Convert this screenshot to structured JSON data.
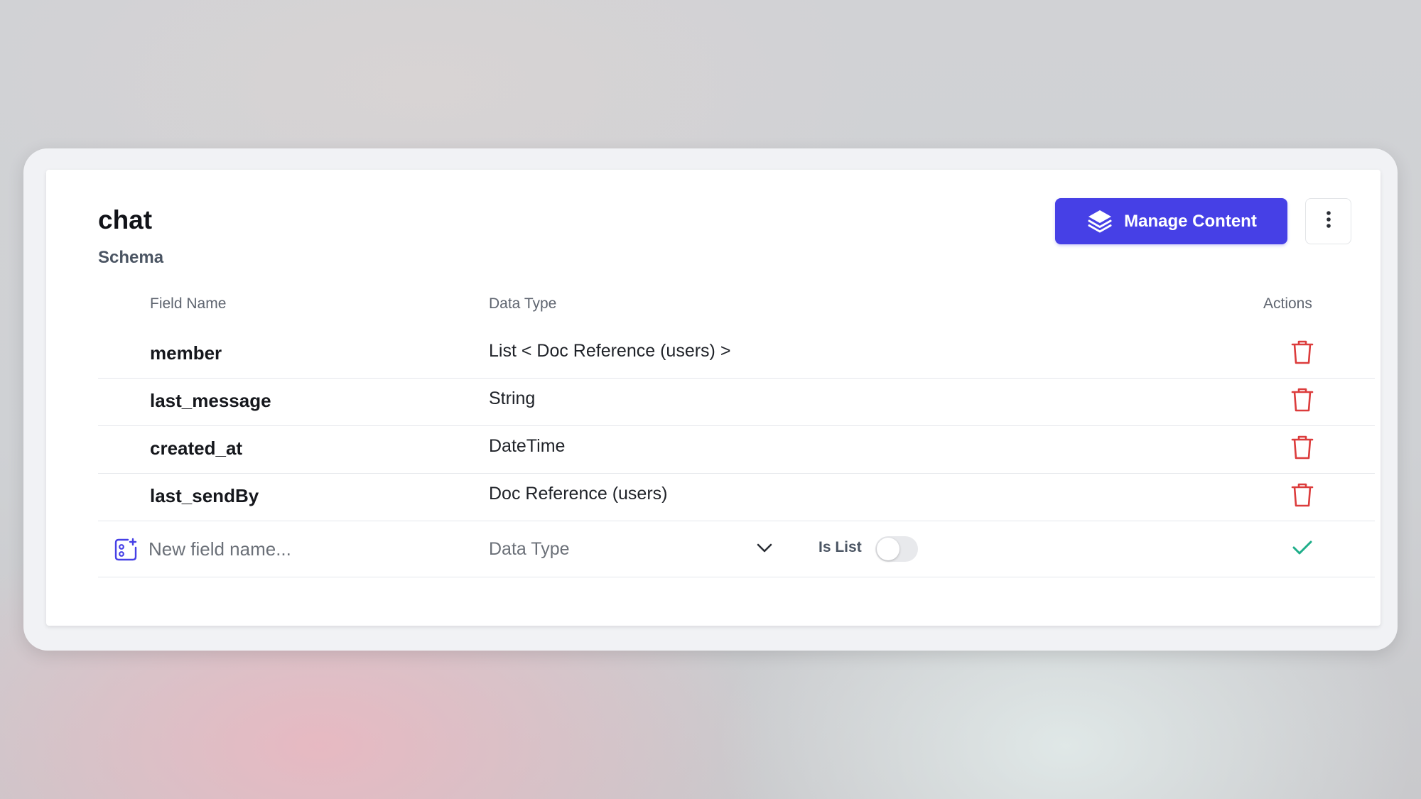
{
  "header": {
    "title": "chat",
    "subtitle": "Schema",
    "manage_button_label": "Manage Content"
  },
  "table": {
    "columns": {
      "field_name": "Field Name",
      "data_type": "Data Type",
      "actions": "Actions"
    },
    "rows": [
      {
        "name": "member",
        "type": "List < Doc Reference (users) >"
      },
      {
        "name": "last_message",
        "type": "String"
      },
      {
        "name": "created_at",
        "type": "DateTime"
      },
      {
        "name": "last_sendBy",
        "type": "Doc Reference (users)"
      }
    ]
  },
  "new_field": {
    "placeholder": "New field name...",
    "data_type_placeholder": "Data Type",
    "is_list_label": "Is List",
    "is_list_enabled": false
  },
  "colors": {
    "accent": "#4640e6",
    "delete": "#dc3c3c",
    "confirm": "#1fae8a"
  },
  "icons": {
    "manage": "layers-icon",
    "menu": "more-vertical-icon",
    "delete": "trash-icon",
    "add_field": "add-field-icon",
    "dropdown": "chevron-down-icon",
    "confirm": "check-icon"
  }
}
